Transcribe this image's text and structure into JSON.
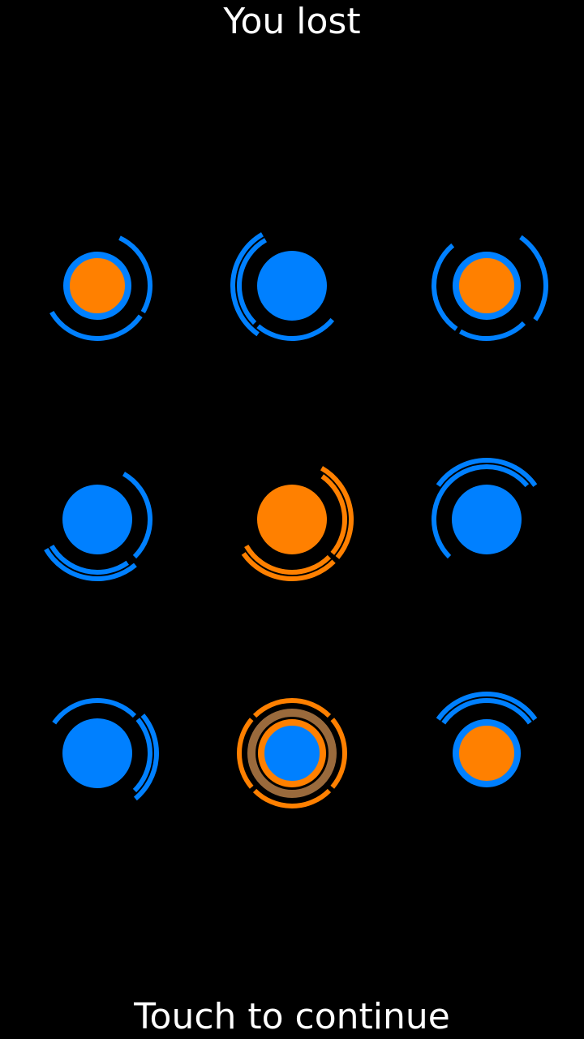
{
  "status_title": "You lost",
  "continue_prompt": "Touch to continue",
  "colors": {
    "background": "#000000",
    "blue": "#0080FF",
    "orange": "#FF8000",
    "brown": "#9A6A3C"
  },
  "grid": [
    {
      "row": 1,
      "col": 1,
      "core": "orange",
      "core_ring": "blue",
      "arcs": [
        {
          "color": "blue",
          "radius": "outer",
          "start": -65,
          "end": 30
        },
        {
          "color": "blue",
          "radius": "outer",
          "start": 35,
          "end": 150
        }
      ]
    },
    {
      "row": 1,
      "col": 2,
      "core": "blue",
      "arcs": [
        {
          "color": "blue",
          "radius": "outer",
          "start": 135,
          "end": 240
        },
        {
          "color": "blue",
          "radius": "outer2",
          "start": 125,
          "end": 240
        },
        {
          "color": "blue",
          "radius": "outer",
          "start": 40,
          "end": 130
        }
      ]
    },
    {
      "row": 1,
      "col": 3,
      "core": "orange",
      "core_ring": "blue",
      "arcs": [
        {
          "color": "blue",
          "radius": "outer",
          "start": 125,
          "end": 230
        },
        {
          "color": "blue",
          "radius": "outer",
          "start": 45,
          "end": 120
        },
        {
          "color": "blue",
          "radius": "outer2",
          "start": -55,
          "end": 35
        }
      ]
    },
    {
      "row": 2,
      "col": 1,
      "core": "blue",
      "arcs": [
        {
          "color": "blue",
          "radius": "outer",
          "start": -60,
          "end": 45
        },
        {
          "color": "blue",
          "radius": "outer",
          "start": 55,
          "end": 150
        },
        {
          "color": "blue",
          "radius": "outer2",
          "start": 50,
          "end": 150
        }
      ]
    },
    {
      "row": 2,
      "col": 2,
      "core": "orange",
      "arcs": [
        {
          "color": "orange",
          "radius": "outer",
          "start": -55,
          "end": 40
        },
        {
          "color": "orange",
          "radius": "outer2",
          "start": -60,
          "end": 40
        },
        {
          "color": "orange",
          "radius": "outer",
          "start": 45,
          "end": 150
        },
        {
          "color": "orange",
          "radius": "outer2",
          "start": 45,
          "end": 145
        }
      ]
    },
    {
      "row": 2,
      "col": 3,
      "core": "blue",
      "arcs": [
        {
          "color": "blue",
          "radius": "outer",
          "start": 135,
          "end": 230
        },
        {
          "color": "blue",
          "radius": "outer",
          "start": -140,
          "end": -40
        },
        {
          "color": "blue",
          "radius": "outer2",
          "start": -145,
          "end": -35
        }
      ]
    },
    {
      "row": 3,
      "col": 1,
      "core": "blue",
      "arcs": [
        {
          "color": "blue",
          "radius": "outer",
          "start": -145,
          "end": -45
        },
        {
          "color": "blue",
          "radius": "outer",
          "start": -40,
          "end": 45
        },
        {
          "color": "blue",
          "radius": "outer2",
          "start": -40,
          "end": 50
        }
      ]
    },
    {
      "row": 3,
      "col": 2,
      "core": "blue",
      "core_ring": "orange",
      "arcs": [
        {
          "color": "brown",
          "radius": "mid",
          "start": 0,
          "end": 360
        },
        {
          "color": "orange",
          "radius": "outer",
          "start": -135,
          "end": -45
        },
        {
          "color": "orange",
          "radius": "outer",
          "start": -40,
          "end": 40
        },
        {
          "color": "orange",
          "radius": "outer",
          "start": 45,
          "end": 135
        },
        {
          "color": "orange",
          "radius": "outer",
          "start": 140,
          "end": 220
        }
      ]
    },
    {
      "row": 3,
      "col": 3,
      "core": "orange",
      "core_ring": "blue",
      "arcs": [
        {
          "color": "blue",
          "radius": "outer",
          "start": -145,
          "end": -35
        },
        {
          "color": "blue",
          "radius": "outer2",
          "start": -145,
          "end": -35
        }
      ]
    }
  ]
}
